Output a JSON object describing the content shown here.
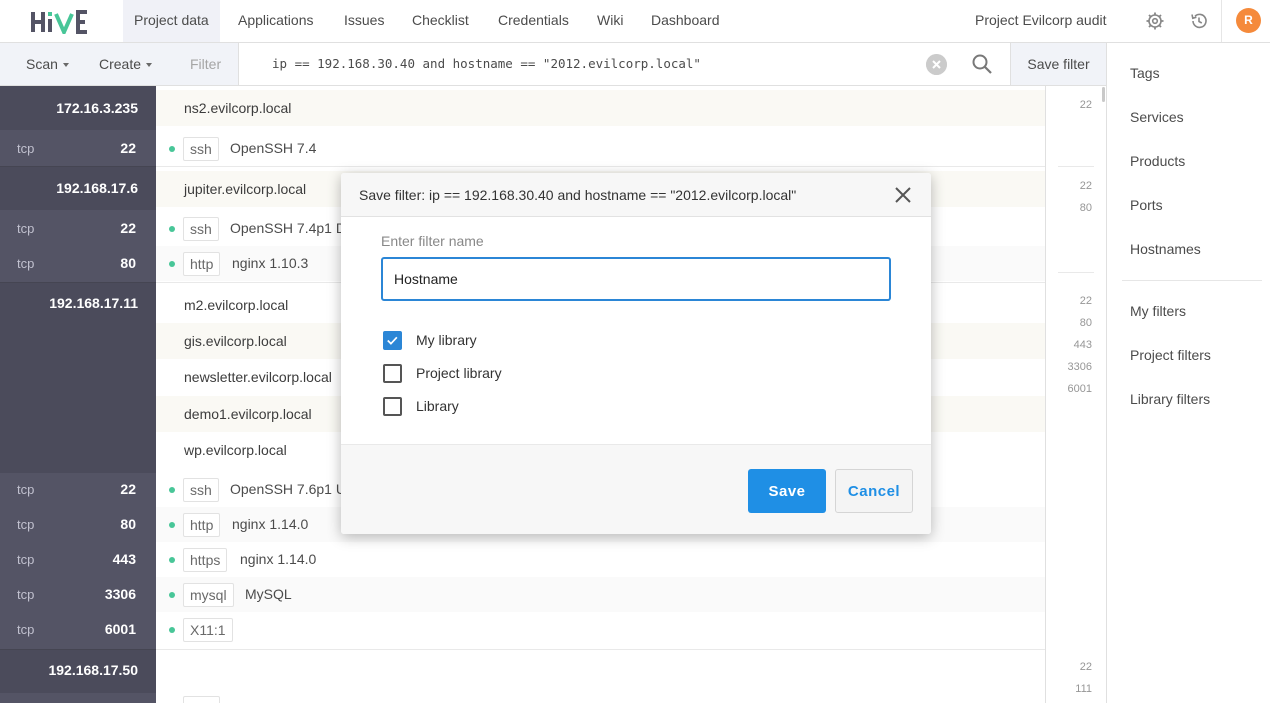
{
  "app": {
    "logo_text": "HIVE"
  },
  "nav": {
    "items": [
      {
        "label": "Project data"
      },
      {
        "label": "Applications"
      },
      {
        "label": "Issues"
      },
      {
        "label": "Checklist"
      },
      {
        "label": "Credentials"
      },
      {
        "label": "Wiki"
      },
      {
        "label": "Dashboard"
      }
    ],
    "active": "Project data",
    "project_title": "Project Evilcorp audit",
    "avatar_initial": "R"
  },
  "filterbar": {
    "scan_label": "Scan",
    "create_label": "Create",
    "filter_label": "Filter",
    "query": "ip == 192.168.30.40 and hostname == \"2012.evilcorp.local\"",
    "save_filter_label": "Save filter"
  },
  "hosts": {
    "ips": [
      "172.16.3.235",
      "192.168.17.6",
      "192.168.17.11",
      "192.168.17.50"
    ],
    "proto": "tcp",
    "ports": [
      "22",
      "22",
      "80",
      "22",
      "80",
      "443",
      "3306",
      "6001"
    ],
    "hostnames": [
      "ns2.evilcorp.local",
      "jupiter.evilcorp.local",
      "m2.evilcorp.local",
      "gis.evilcorp.local",
      "newsletter.evilcorp.local",
      "demo1.evilcorp.local",
      "wp.evilcorp.local"
    ],
    "services": [
      {
        "tag": "ssh",
        "desc": "OpenSSH 7.4"
      },
      {
        "tag": "ssh",
        "desc": "OpenSSH 7.4p1 D"
      },
      {
        "tag": "http",
        "desc": "nginx 1.10.3"
      },
      {
        "tag": "ssh",
        "desc": "OpenSSH 7.6p1 U"
      },
      {
        "tag": "http",
        "desc": "nginx 1.14.0"
      },
      {
        "tag": "https",
        "desc": "nginx 1.14.0"
      },
      {
        "tag": "mysql",
        "desc": "MySQL"
      },
      {
        "tag": "X11:1",
        "desc": ""
      }
    ]
  },
  "port_column": [
    "22",
    "22",
    "80",
    "22",
    "80",
    "443",
    "3306",
    "6001",
    "22",
    "111"
  ],
  "sidebar": {
    "items": [
      "Tags",
      "Services",
      "Products",
      "Ports",
      "Hostnames"
    ],
    "filters": [
      "My filters",
      "Project filters",
      "Library filters"
    ]
  },
  "modal": {
    "title": "Save filter: ip == 192.168.30.40 and hostname == \"2012.evilcorp.local\"",
    "name_label": "Enter filter name",
    "name_value": "Hostname",
    "checkboxes": [
      {
        "label": "My library",
        "checked": true
      },
      {
        "label": "Project library",
        "checked": false
      },
      {
        "label": "Library",
        "checked": false
      }
    ],
    "save_label": "Save",
    "cancel_label": "Cancel"
  },
  "colors": {
    "accent": "#1f8fe5",
    "left_column": "#3d3d50",
    "service_dot": "#2fbf8a",
    "avatar": "#f47a20"
  }
}
